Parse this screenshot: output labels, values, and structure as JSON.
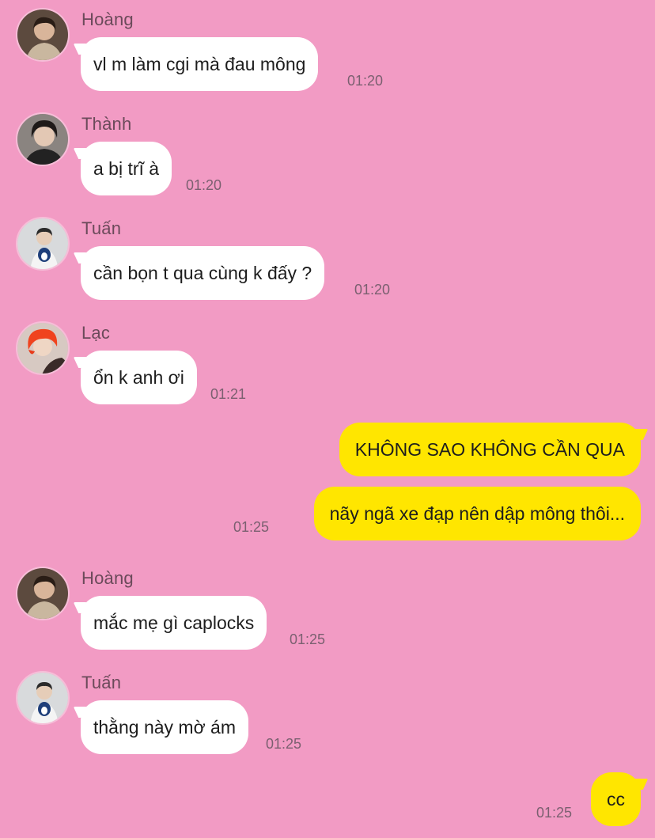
{
  "colors": {
    "background": "#f29bc4",
    "incoming_bubble": "#ffffff",
    "outgoing_bubble": "#ffe600"
  },
  "messages": [
    {
      "sender": "Hoàng",
      "text": "vl m làm cgi mà đau mông",
      "time": "01:20",
      "avatar": "avatar-hoang"
    },
    {
      "sender": "Thành",
      "text": "a bị trĩ à",
      "time": "01:20",
      "avatar": "avatar-thanh"
    },
    {
      "sender": "Tuấn",
      "text": "cần bọn t qua cùng k đấy ?",
      "time": "01:20",
      "avatar": "avatar-tuan"
    },
    {
      "sender": "Lạc",
      "text": "ổn k anh ơi",
      "time": "01:21",
      "avatar": "avatar-lac"
    },
    {
      "sender": "Hoàng",
      "text": "mắc mẹ gì caplocks",
      "time": "01:25",
      "avatar": "avatar-hoang"
    },
    {
      "sender": "Tuấn",
      "text": "thằng này mờ ám",
      "time": "01:25",
      "avatar": "avatar-tuan"
    }
  ],
  "outgoing": [
    {
      "text": "KHÔNG SAO KHÔNG CẦN QUA"
    },
    {
      "text": "nãy ngã xe đạp nên dập mông thôi...",
      "time": "01:25"
    },
    {
      "text": "cc",
      "time": "01:25"
    }
  ]
}
